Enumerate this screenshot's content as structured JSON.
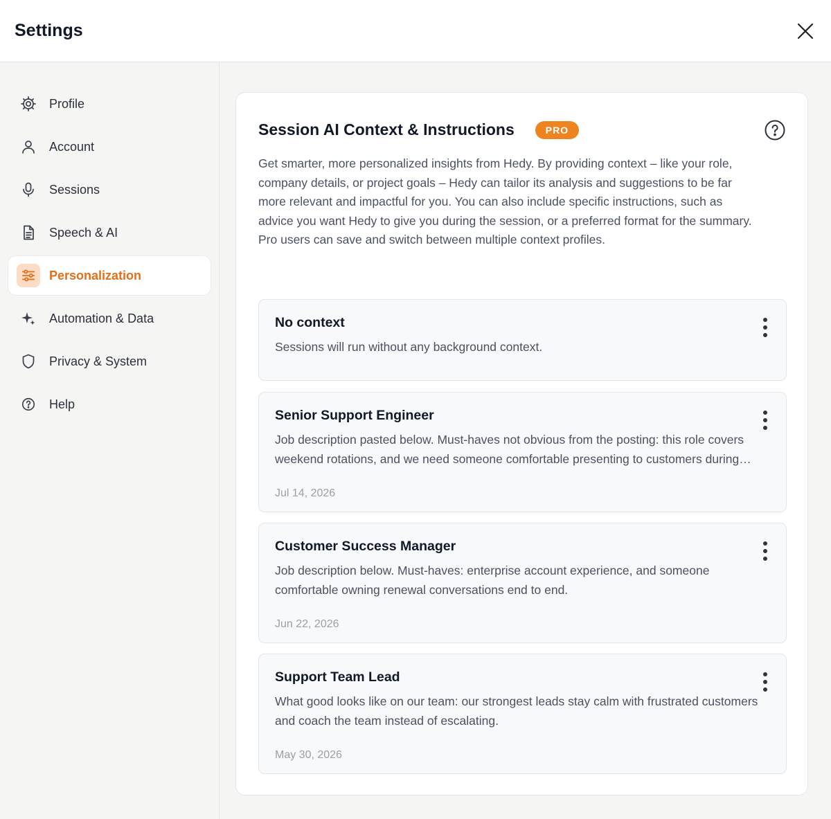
{
  "header": {
    "title": "Settings",
    "close_icon": "close-icon"
  },
  "sidebar": {
    "items": [
      {
        "label": "Profile",
        "icon": "gear-icon",
        "active": false
      },
      {
        "label": "Account",
        "icon": "user-icon",
        "active": false
      },
      {
        "label": "Sessions",
        "icon": "microphone-icon",
        "active": false
      },
      {
        "label": "Speech & AI",
        "icon": "document-icon",
        "active": false
      },
      {
        "label": "Personalization",
        "icon": "sliders-icon",
        "active": true
      },
      {
        "label": "Automation & Data",
        "icon": "sparkles-icon",
        "active": false
      },
      {
        "label": "Privacy & System",
        "icon": "shield-icon",
        "active": false
      },
      {
        "label": "Help",
        "icon": "help-circle-icon",
        "active": false
      }
    ]
  },
  "main": {
    "title": "Session AI Context & Instructions",
    "badge": "PRO",
    "intro": "Get smarter, more personalized insights from Hedy. By providing context – like your role, company details, or project goals – Hedy can tailor its analysis and suggestions to be far more relevant and impactful for you. You can also include specific instructions, such as advice you want Hedy to give you during the session, or a preferred format for the summary. Pro users can save and switch between multiple context profiles.",
    "profiles": [
      {
        "name": "No context",
        "description": "Sessions will run without any background context.",
        "date": ""
      },
      {
        "name": "Senior Support Engineer",
        "description": "Job description pasted below. Must-haves not obvious from the posting: this role covers weekend rotations, and we need someone comfortable presenting to customers during escalations.",
        "date": "Jul 14, 2026"
      },
      {
        "name": "Customer Success Manager",
        "description": "Job description below. Must-haves: enterprise account experience, and someone comfortable owning renewal conversations end to end.",
        "date": "Jun 22, 2026"
      },
      {
        "name": "Support Team Lead",
        "description": "What good looks like on our team: our strongest leads stay calm with frustrated customers and coach the team instead of escalating.",
        "date": "May 30, 2026"
      }
    ]
  },
  "colors": {
    "accent": "#ee8420",
    "accent_text": "#e0701a",
    "accent_bg": "#fcdcc4"
  }
}
